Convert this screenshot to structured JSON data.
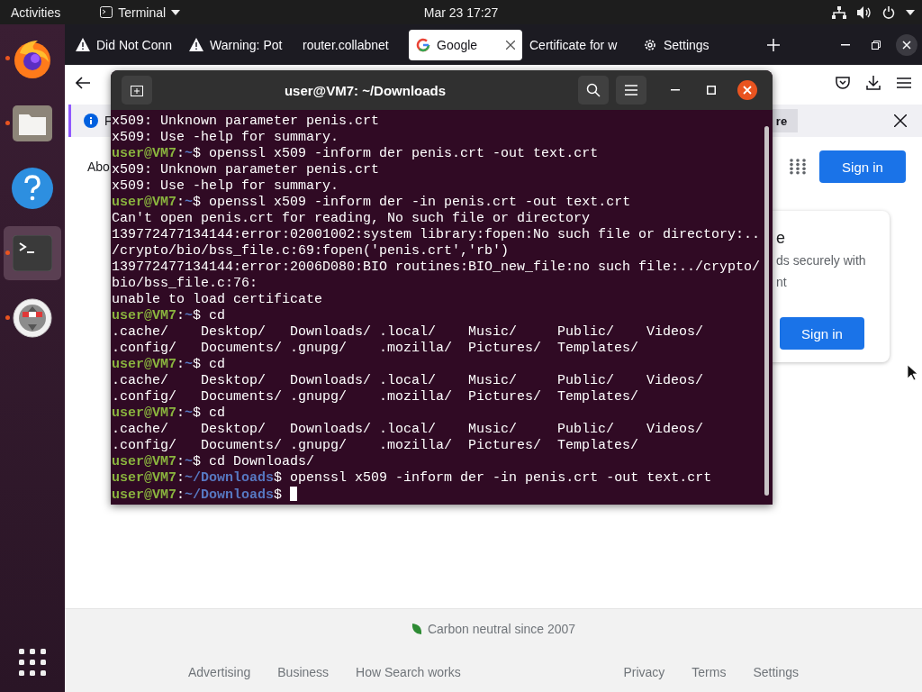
{
  "top_bar": {
    "activities": "Activities",
    "app_menu": "Terminal",
    "clock": "Mar 23  17:27"
  },
  "dock": {
    "items": [
      {
        "kind": "firefox",
        "running": true,
        "selected": false
      },
      {
        "kind": "files",
        "running": true,
        "selected": false
      },
      {
        "kind": "help",
        "running": false,
        "selected": false
      },
      {
        "kind": "terminal",
        "running": true,
        "selected": true
      },
      {
        "kind": "installer",
        "running": true,
        "selected": false
      }
    ]
  },
  "browser": {
    "tabs": [
      {
        "kind": "warning",
        "label": "Did Not Conn",
        "selected": false
      },
      {
        "kind": "warning",
        "label": "Warning: Pot",
        "selected": false
      },
      {
        "kind": "plain",
        "label": "router.collabnet",
        "selected": false
      },
      {
        "kind": "google",
        "label": "Google",
        "selected": true
      },
      {
        "kind": "plain",
        "label": "Certificate for w",
        "selected": false
      },
      {
        "kind": "gear",
        "label": "Settings",
        "selected": false
      }
    ],
    "notification": {
      "text": "F",
      "button": "re"
    },
    "page": {
      "nav_link": "Abo",
      "sign_in": "Sign in",
      "card": {
        "title": "e",
        "text_lines": [
          "ds securely with",
          "nt"
        ],
        "button": "Sign in"
      },
      "footer": {
        "carbon": "Carbon neutral since 2007",
        "left_links": [
          "Advertising",
          "Business",
          "How Search works"
        ],
        "right_links": [
          "Privacy",
          "Terms",
          "Settings"
        ]
      }
    }
  },
  "terminal": {
    "title": "user@VM7: ~/Downloads",
    "lines": [
      {
        "kind": "output",
        "text": "x509: Unknown parameter penis.crt"
      },
      {
        "kind": "output",
        "text": "x509: Use -help for summary."
      },
      {
        "kind": "prompt",
        "user": "user@VM7",
        "sep": ":",
        "path": "~",
        "dollar": "$ ",
        "command": "openssl x509 -inform der penis.crt -out text.crt"
      },
      {
        "kind": "output",
        "text": "x509: Unknown parameter penis.crt"
      },
      {
        "kind": "output",
        "text": "x509: Use -help for summary."
      },
      {
        "kind": "prompt",
        "user": "user@VM7",
        "sep": ":",
        "path": "~",
        "dollar": "$ ",
        "command": "openssl x509 -inform der -in penis.crt -out text.crt"
      },
      {
        "kind": "output",
        "text": "Can't open penis.crt for reading, No such file or directory"
      },
      {
        "kind": "output",
        "text": "139772477134144:error:02001002:system library:fopen:No such file or directory:.."
      },
      {
        "kind": "output",
        "text": "/crypto/bio/bss_file.c:69:fopen('penis.crt','rb')"
      },
      {
        "kind": "output",
        "text": "139772477134144:error:2006D080:BIO routines:BIO_new_file:no such file:../crypto/"
      },
      {
        "kind": "output",
        "text": "bio/bss_file.c:76:"
      },
      {
        "kind": "output",
        "text": "unable to load certificate"
      },
      {
        "kind": "prompt",
        "user": "user@VM7",
        "sep": ":",
        "path": "~",
        "dollar": "$ ",
        "command": "cd"
      },
      {
        "kind": "output",
        "text": ".cache/    Desktop/   Downloads/ .local/    Music/     Public/    Videos/"
      },
      {
        "kind": "output",
        "text": ".config/   Documents/ .gnupg/    .mozilla/  Pictures/  Templates/"
      },
      {
        "kind": "prompt",
        "user": "user@VM7",
        "sep": ":",
        "path": "~",
        "dollar": "$ ",
        "command": "cd"
      },
      {
        "kind": "output",
        "text": ".cache/    Desktop/   Downloads/ .local/    Music/     Public/    Videos/"
      },
      {
        "kind": "output",
        "text": ".config/   Documents/ .gnupg/    .mozilla/  Pictures/  Templates/"
      },
      {
        "kind": "prompt",
        "user": "user@VM7",
        "sep": ":",
        "path": "~",
        "dollar": "$ ",
        "command": "cd"
      },
      {
        "kind": "output",
        "text": ".cache/    Desktop/   Downloads/ .local/    Music/     Public/    Videos/"
      },
      {
        "kind": "output",
        "text": ".config/   Documents/ .gnupg/    .mozilla/  Pictures/  Templates/"
      },
      {
        "kind": "prompt",
        "user": "user@VM7",
        "sep": ":",
        "path": "~",
        "dollar": "$ ",
        "command": "cd Downloads/"
      },
      {
        "kind": "prompt",
        "user": "user@VM7",
        "sep": ":",
        "path": "~/Downloads",
        "dollar": "$ ",
        "command": "openssl x509 -inform der -in penis.crt -out text.crt"
      },
      {
        "kind": "prompt",
        "user": "user@VM7",
        "sep": ":",
        "path": "~/Downloads",
        "dollar": "$ ",
        "cursor": true
      }
    ]
  }
}
